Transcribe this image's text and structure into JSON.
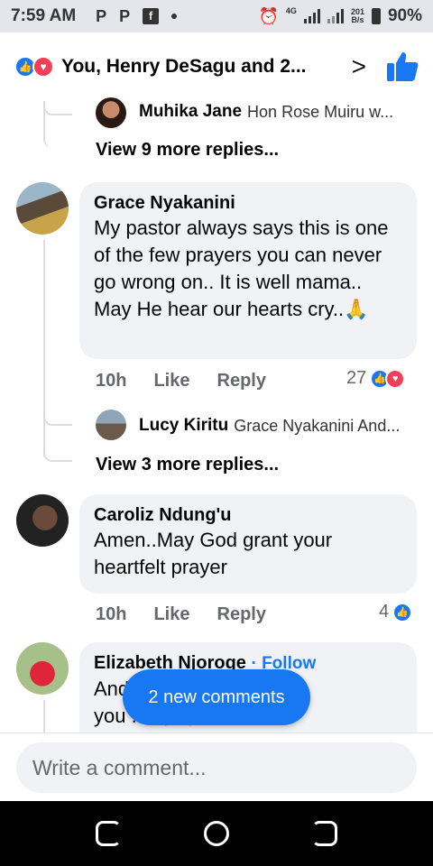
{
  "status_bar": {
    "time": "7:59 AM",
    "notif_icons": [
      "P",
      "P",
      "fb",
      "•"
    ],
    "network_label": "4G",
    "speed_top": "201",
    "speed_bottom": "B/s",
    "battery": "90%"
  },
  "header": {
    "title": "You, Henry DeSagu and 2...",
    "reaction_icons": [
      "like-icon",
      "love-icon"
    ]
  },
  "threads": [
    {
      "reply_preview": {
        "name": "Muhika Jane",
        "snippet": "Hon Rose Muiru w..."
      },
      "view_more": "View 9 more replies..."
    }
  ],
  "comments": [
    {
      "name": "Grace Nyakanini",
      "text": "My pastor always says this is one of the few prayers you can never go wrong on.. It is well mama.. May He hear our hearts cry..🙏",
      "time": "10h",
      "like_label": "Like",
      "reply_label": "Reply",
      "reaction_count": "27",
      "reply_preview": {
        "name": "Lucy Kiritu",
        "snippet": "Grace Nyakanini And..."
      },
      "view_more": "View 3 more replies..."
    },
    {
      "name": "Caroliz Ndung'u",
      "text": "Amen..May God grant your heartfelt prayer",
      "time": "10h",
      "like_label": "Like",
      "reply_label": "Reply",
      "reaction_count": "4"
    },
    {
      "name": "Elizabeth Njoroge",
      "follow_label": "· Follow",
      "text_line1": "And ... volved",
      "text_line2": "you ... ❤️❤️He"
    }
  ],
  "new_comments_pill": "2 new comments",
  "composer": {
    "placeholder": "Write a comment..."
  },
  "colors": {
    "accent": "#1877f2",
    "love": "#f33e58",
    "bubble": "#f0f2f5",
    "secondary_text": "#65676b"
  }
}
